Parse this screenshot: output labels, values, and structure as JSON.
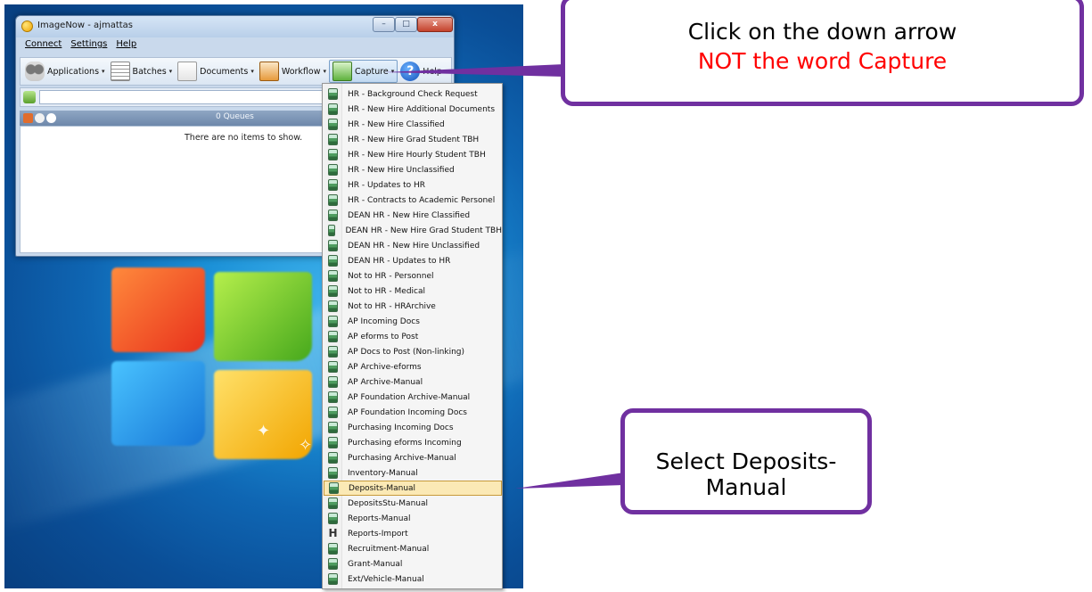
{
  "window": {
    "title": "ImageNow - ajmattas",
    "min": "–",
    "max": "□",
    "close": "x"
  },
  "menu": [
    "Connect",
    "Settings",
    "Help"
  ],
  "toolbar": {
    "applications": "Applications",
    "batches": "Batches",
    "documents": "Documents",
    "workflow": "Workflow",
    "capture": "Capture",
    "help": "Help",
    "arrow": "▾"
  },
  "queues": {
    "count_label": "0 Queues",
    "empty_message": "There are no items to show."
  },
  "dropdown": {
    "highlighted_index": 26,
    "items": [
      "HR - Background Check Request",
      "HR - New Hire Additional Documents",
      "HR - New Hire Classified",
      "HR - New Hire Grad Student TBH",
      "HR - New Hire Hourly Student TBH",
      "HR - New Hire Unclassified",
      "HR - Updates to HR",
      "HR - Contracts to Academic Personel",
      "DEAN HR - New Hire Classified",
      "DEAN HR - New Hire Grad Student TBH",
      "DEAN HR - New Hire Unclassified",
      "DEAN HR - Updates to HR",
      "Not to HR - Personnel",
      "Not to HR - Medical",
      "Not to HR - HRArchive",
      "AP Incoming Docs",
      "AP eforms to Post",
      "AP Docs to Post (Non-linking)",
      "AP Archive-eforms",
      "AP Archive-Manual",
      "AP Foundation Archive-Manual",
      "AP Foundation Incoming Docs",
      "Purchasing Incoming Docs",
      "Purchasing eforms Incoming",
      "Purchasing Archive-Manual",
      "Inventory-Manual",
      "Deposits-Manual",
      "DepositsStu-Manual",
      "Reports-Manual",
      "Reports-Import",
      "Recruitment-Manual",
      "Grant-Manual",
      "Ext/Vehicle-Manual"
    ]
  },
  "callouts": {
    "top_line1": "Click on the down arrow",
    "top_line2": "NOT the word Capture",
    "bottom": "Select Deposits-Manual",
    "border_color": "#7030a0",
    "emphasis_color": "#ff0000"
  }
}
